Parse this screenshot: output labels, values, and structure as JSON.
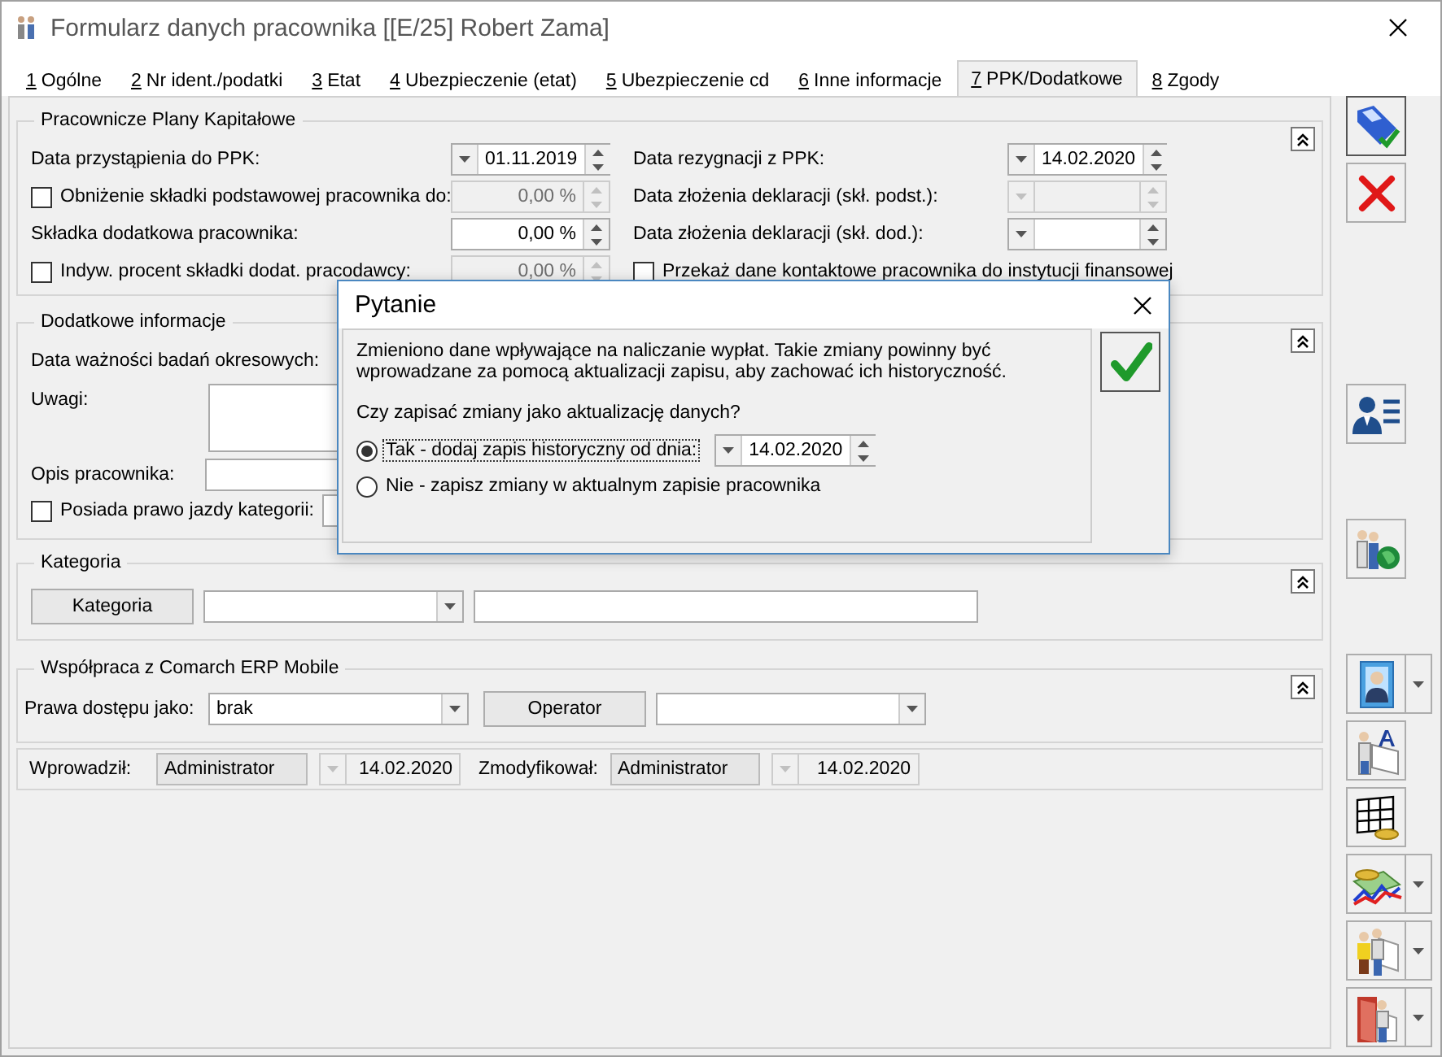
{
  "window": {
    "title": "Formularz danych pracownika [[E/25] Robert Zama]"
  },
  "tabs": [
    {
      "key": "1",
      "label": "Ogólne",
      "selected": false
    },
    {
      "key": "2",
      "label": "Nr ident./podatki",
      "selected": false
    },
    {
      "key": "3",
      "label": "Etat",
      "selected": false
    },
    {
      "key": "4",
      "label": "Ubezpieczenie (etat)",
      "selected": false
    },
    {
      "key": "5",
      "label": "Ubezpieczenie cd",
      "selected": false
    },
    {
      "key": "6",
      "label": "Inne informacje",
      "selected": false
    },
    {
      "key": "7",
      "label": "PPK/Dodatkowe",
      "selected": true
    },
    {
      "key": "8",
      "label": "Zgody",
      "selected": false
    }
  ],
  "ppk": {
    "title": "Pracownicze Plany Kapitałowe",
    "left": [
      {
        "kind": "date",
        "label": "Data przystąpienia do PPK:",
        "value": "01.11.2019",
        "disabled": false
      },
      {
        "kind": "percent_check",
        "label": "Obniżenie składki podstawowej pracownika do:",
        "checked": false,
        "value": "0,00 %",
        "disabled": true
      },
      {
        "kind": "percent",
        "label": "Składka dodatkowa pracownika:",
        "value": "0,00 %",
        "disabled": false
      },
      {
        "kind": "percent_check",
        "label": "Indyw. procent składki dodat. pracodawcy:",
        "checked": false,
        "value": "0,00 %",
        "disabled": true
      }
    ],
    "right": [
      {
        "kind": "date",
        "label": "Data rezygnacji z PPK:",
        "value": "14.02.2020",
        "disabled": false
      },
      {
        "kind": "date",
        "label": "Data złożenia deklaracji (skł. podst.):",
        "disabled": true
      },
      {
        "kind": "date",
        "label": "Data złożenia deklaracji (skł. dod.):",
        "disabled": false
      },
      {
        "kind": "check",
        "label": "Przekaż dane kontaktowe pracownika do instytucji finansowej",
        "checked": false
      }
    ]
  },
  "extra": {
    "title": "Dodatkowe informacje",
    "fields": [
      {
        "kind": "label",
        "label": "Data ważności badań okresowych:"
      },
      {
        "kind": "textarea",
        "label": "Uwagi:"
      },
      {
        "kind": "text",
        "label": "Opis pracownika:"
      },
      {
        "kind": "check",
        "label": "Posiada prawo jazdy kategorii:",
        "checked": false
      }
    ]
  },
  "category": {
    "title": "Kategoria",
    "button": "Kategoria"
  },
  "mobile": {
    "title": "Współpraca z Comarch ERP Mobile",
    "access_label": "Prawa dostępu jako:",
    "access_value": "brak",
    "operator_button": "Operator"
  },
  "audit": {
    "entered_label": "Wprowadził:",
    "entered_by": "Administrator",
    "entered_date": "14.02.2020",
    "modified_label": "Zmodyfikował:",
    "modified_by": "Administrator",
    "modified_date": "14.02.2020"
  },
  "toolbar": [
    {
      "kind": "save",
      "menu": false
    },
    {
      "kind": "cancel",
      "menu": false
    },
    {
      "kind": "gap"
    },
    {
      "kind": "card",
      "menu": false
    },
    {
      "kind": "gap"
    },
    {
      "kind": "globe",
      "menu": false
    },
    {
      "kind": "gap"
    },
    {
      "kind": "portrait",
      "menu": true
    },
    {
      "kind": "letter",
      "menu": false
    },
    {
      "kind": "table",
      "menu": false
    },
    {
      "kind": "chart",
      "menu": true
    },
    {
      "kind": "people",
      "menu": true
    },
    {
      "kind": "door",
      "menu": true
    }
  ],
  "dialog": {
    "title": "Pytanie",
    "message": "Zmieniono dane wpływające na naliczanie wypłat. Takie zmiany powinny być wprowadzane za pomocą aktualizacji zapisu, aby zachować ich historyczność.",
    "question": "Czy zapisać zmiany jako aktualizację danych?",
    "options": [
      {
        "label": "Tak - dodaj zapis historyczny od dnia:",
        "selected": true,
        "date": "14.02.2020"
      },
      {
        "label": "Nie - zapisz zmiany w aktualnym zapisie pracownika",
        "selected": false
      }
    ]
  }
}
